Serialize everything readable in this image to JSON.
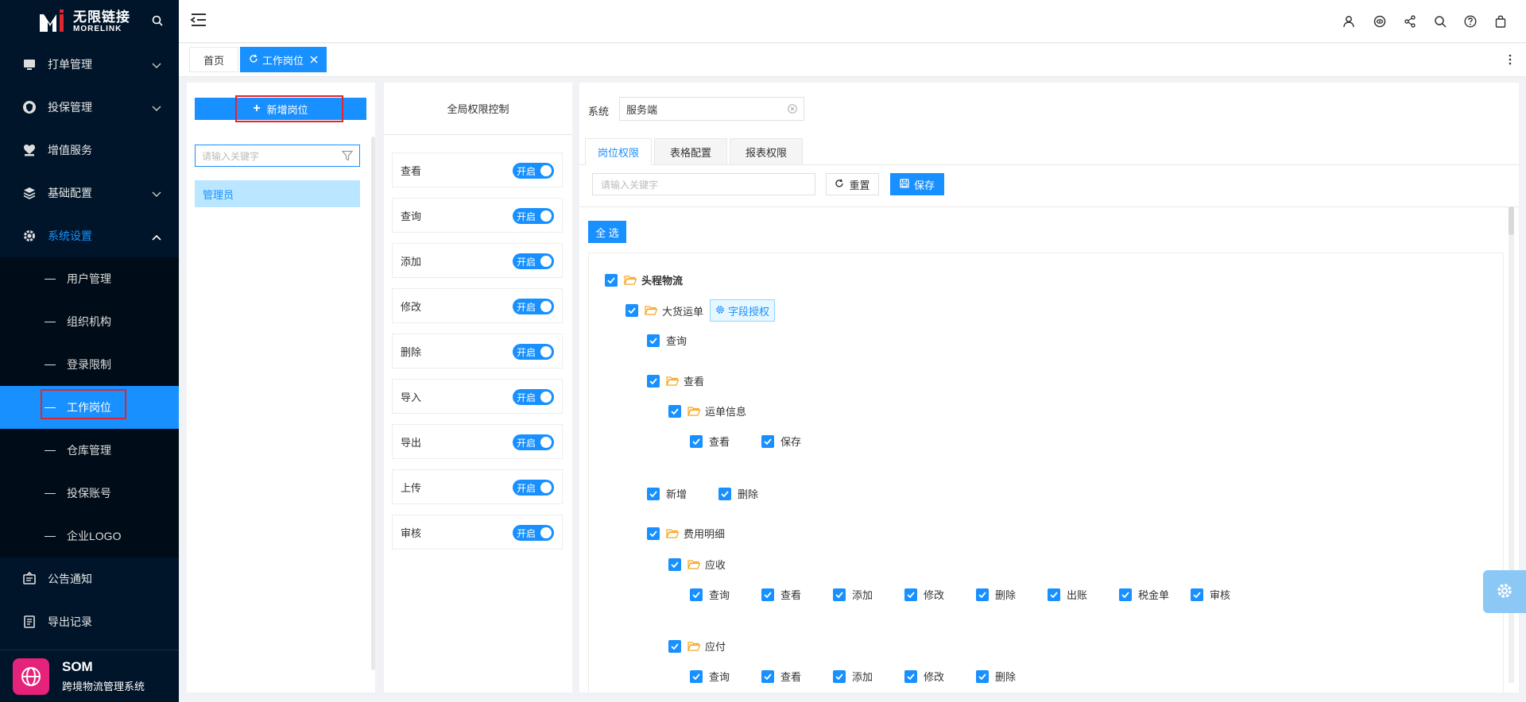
{
  "logo": {
    "cn": "无限链接",
    "en": "MORELINK"
  },
  "sidebar": {
    "items": [
      {
        "label": "打单管理"
      },
      {
        "label": "投保管理"
      },
      {
        "label": "增值服务"
      },
      {
        "label": "基础配置"
      },
      {
        "label": "系统设置"
      }
    ],
    "sub_items": [
      {
        "label": "用户管理"
      },
      {
        "label": "组织机构"
      },
      {
        "label": "登录限制"
      },
      {
        "label": "工作岗位"
      },
      {
        "label": "仓库管理"
      },
      {
        "label": "投保账号"
      },
      {
        "label": "企业LOGO"
      }
    ],
    "bottom_items": [
      {
        "label": "公告通知"
      },
      {
        "label": "导出记录"
      }
    ]
  },
  "brand": {
    "title": "SOM",
    "subtitle": "跨境物流管理系统"
  },
  "tabs": {
    "home": "首页",
    "active": "工作岗位"
  },
  "positions": {
    "add_label": "新增岗位",
    "search_placeholder": "请输入关键字",
    "items": [
      "管理员"
    ]
  },
  "global_perm": {
    "title": "全局权限控制",
    "switch_label": "开启",
    "items": [
      "查看",
      "查询",
      "添加",
      "修改",
      "删除",
      "导入",
      "导出",
      "上传",
      "审核"
    ]
  },
  "detail": {
    "system_label": "系统",
    "system_value": "服务端",
    "tabs": [
      "岗位权限",
      "表格配置",
      "报表权限"
    ],
    "keyword_placeholder": "请输入关键字",
    "reset_label": "重置",
    "save_label": "保存",
    "select_all_label": "全 选",
    "field_auth_label": "字段授权",
    "tree": {
      "root": "头程物流",
      "order": "大货运单",
      "query": "查询",
      "view": "查看",
      "waybill_info": "运单信息",
      "wi_view": "查看",
      "wi_save": "保存",
      "add": "新增",
      "delete": "删除",
      "fee_detail": "费用明细",
      "receivable": "应收",
      "receivable_ops": [
        "查询",
        "查看",
        "添加",
        "修改",
        "删除",
        "出账",
        "税金单",
        "审核"
      ],
      "payable": "应付",
      "payable_ops": [
        "查询",
        "查看",
        "添加",
        "修改",
        "删除"
      ]
    }
  },
  "colors": {
    "primary": "#1890ff",
    "sidebar": "#001529",
    "highlight": "#e0262f"
  }
}
